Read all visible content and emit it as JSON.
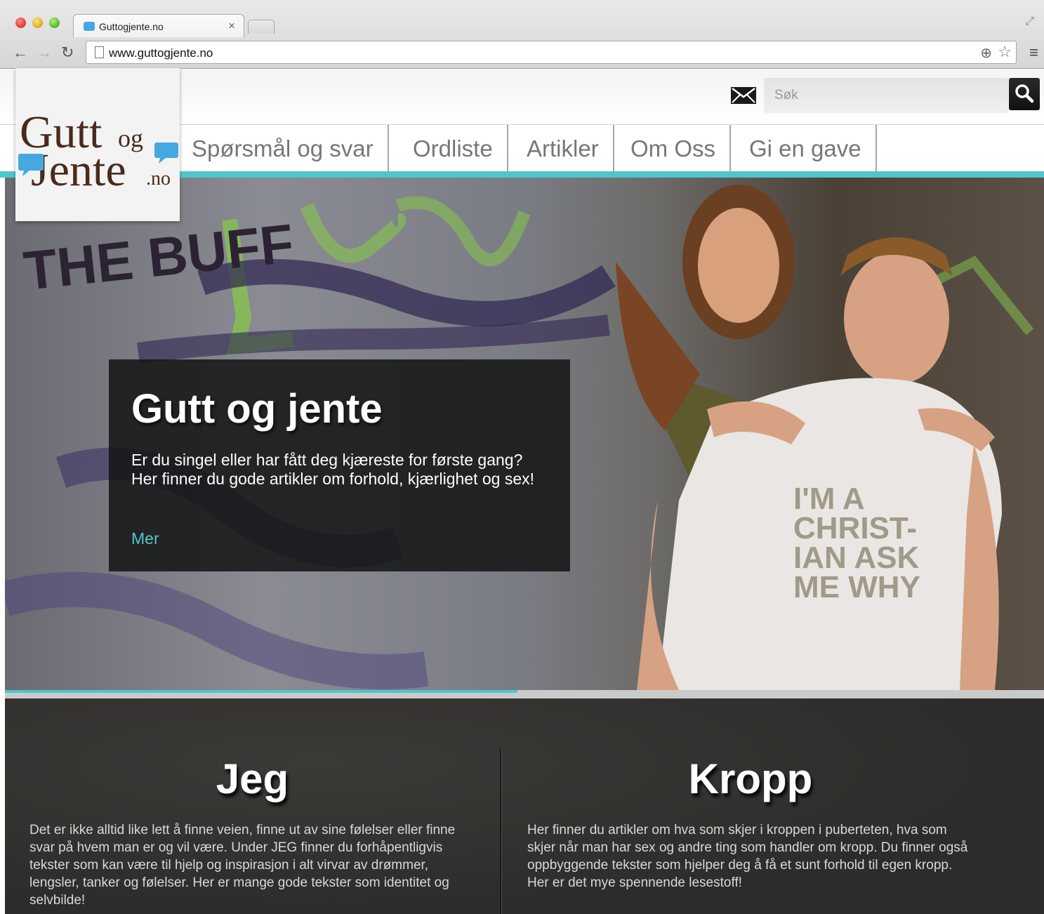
{
  "browser": {
    "tab_title": "Guttogjente.no",
    "tab_close": "×",
    "url": "www.guttogjente.no"
  },
  "header": {
    "logo": {
      "gutt": "Gutt",
      "og": "og",
      "jente": "Jente",
      "no": ".no"
    },
    "search": {
      "placeholder": "Søk"
    },
    "nav": [
      "Spørsmål og svar",
      "Ordliste",
      "Artikler",
      "Om Oss",
      "Gi en gave"
    ]
  },
  "hero": {
    "title": "Gutt og jente",
    "text_line1": "Er du singel eller har fått deg kjæreste for første gang?",
    "text_line2": "Her finner du gode artikler om forhold, kjærlighet og sex!",
    "more_link": "Mer",
    "graffiti_text": "THE BUFF",
    "shirt_text": "I'M A CHRIST-IAN ASK ME WHY"
  },
  "sections": [
    {
      "title": "Jeg",
      "text": "Det er ikke alltid like lett å finne veien, finne ut av sine følelser eller finne svar på hvem man er og vil være. Under JEG finner du forhåpentligvis tekster som kan være til hjelp og inspirasjon i alt virvar av drømmer, lengsler, tanker og følelser. Her er mange gode tekster som identitet og selvbilde!"
    },
    {
      "title": "Kropp",
      "text": "Her finner du artikler om hva som skjer i kroppen i puberteten, hva som skjer når man har sex og andre ting som handler om kropp. Du finner også oppbyggende tekster som hjelper deg å få et sunt forhold til egen kropp. Her er det mye spennende lesestoff!"
    }
  ],
  "colors": {
    "accent": "#4ec6cd",
    "logo_brown": "#4a2a1c",
    "logo_blue": "#45a9e0",
    "section_bg": "#33312e"
  },
  "icons": [
    "close-icon",
    "back-arrow-icon",
    "forward-arrow-icon",
    "reload-icon",
    "page-icon",
    "zoom-icon",
    "star-icon",
    "menu-icon",
    "mail-icon",
    "search-icon",
    "expand-icon"
  ]
}
